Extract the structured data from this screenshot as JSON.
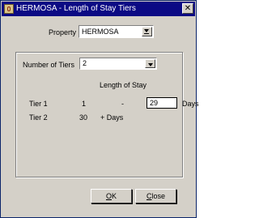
{
  "window": {
    "title": "HERMOSA - Length of Stay Tiers",
    "close_glyph": "✕",
    "icon": "app-icon"
  },
  "property": {
    "label": "Property",
    "value": "HERMOSA",
    "lov_icon": "lov-arrow-icon"
  },
  "tiers": {
    "label": "Number of Tiers",
    "value": "2",
    "dropdown_icon": "chevron-down-icon"
  },
  "length_of_stay": {
    "header": "Length of Stay",
    "rows": [
      {
        "label": "Tier 1",
        "from": "1",
        "separator": "-",
        "to": "29",
        "unit": "Days"
      },
      {
        "label": "Tier 2",
        "from": "30",
        "suffix": "+ Days"
      }
    ]
  },
  "buttons": {
    "ok_underlined": "O",
    "ok_rest": "K",
    "close_underlined": "C",
    "close_rest": "lose"
  }
}
